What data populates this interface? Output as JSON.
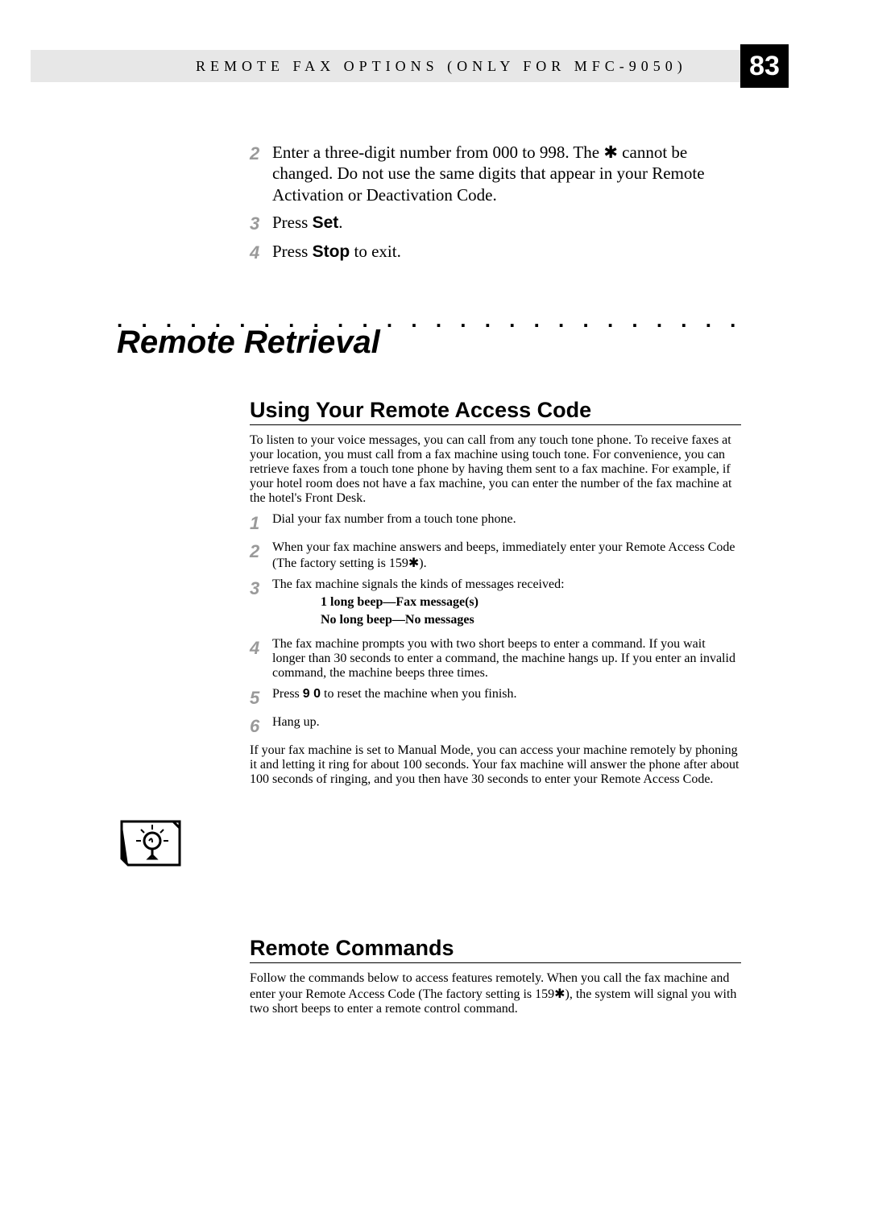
{
  "header": {
    "running_title": "REMOTE FAX OPTIONS (ONLY FOR MFC-9050)",
    "page_number": "83"
  },
  "intro_steps": {
    "s2": "Enter a three-digit number from 000 to  998. The ✱ cannot be changed. Do not use the same digits that appear in your Remote Activation or Deactivation Code.",
    "s3_pre": "Press ",
    "s3_bold": "Set",
    "s3_post": ".",
    "s4_pre": "Press ",
    "s4_bold": "Stop",
    "s4_post": " to exit."
  },
  "section": {
    "dots": ". . . . . . . . . . . . . . . . . . . . . . . . . . . . . . . . . . . . . . . . . . . . . . . . . . . . . . . . . . . . . . . . . . . . . . . . .",
    "title": "Remote Retrieval"
  },
  "sub1": {
    "heading": "Using Your Remote Access Code",
    "para": "To listen to your voice messages, you can call from any touch tone phone. To receive faxes at your location, you must call from a fax machine using touch tone. For convenience, you can retrieve faxes from a touch tone phone by having them sent to a fax machine. For example, if your hotel room does not have a fax machine, you can enter the number of the fax machine at the hotel's Front Desk.",
    "s1": "Dial your fax number from a touch tone phone.",
    "s2": "When your fax machine answers and beeps, immediately enter your Remote Access Code (The factory setting is 159✱).",
    "s3": "The fax machine signals the kinds of messages received:",
    "s3_line1": "1 long beep—Fax message(s)",
    "s3_line2": "No long beep—No messages",
    "s4": "The fax machine prompts you with two short beeps to enter a command. If you wait longer than 30 seconds to enter a command, the machine hangs up. If you enter an invalid command, the machine beeps three times.",
    "s5_pre": "Press ",
    "s5_bold": "9 0",
    "s5_post": " to reset the machine when you finish.",
    "s6": "Hang up.",
    "note": "If your fax machine is set to Manual Mode, you can access your machine remotely by phoning it and letting it ring for about 100 seconds. Your fax machine will answer the phone after about 100 seconds of ringing, and you then have 30 seconds to enter your Remote Access Code."
  },
  "sub2": {
    "heading": "Remote Commands",
    "para": "Follow the commands below to access features remotely. When you call the fax machine and enter your Remote Access Code (The factory setting is 159✱), the system will signal you with two short beeps to enter a remote control command."
  },
  "nums": {
    "n1": "1",
    "n2": "2",
    "n3": "3",
    "n4": "4",
    "n5": "5",
    "n6": "6"
  }
}
